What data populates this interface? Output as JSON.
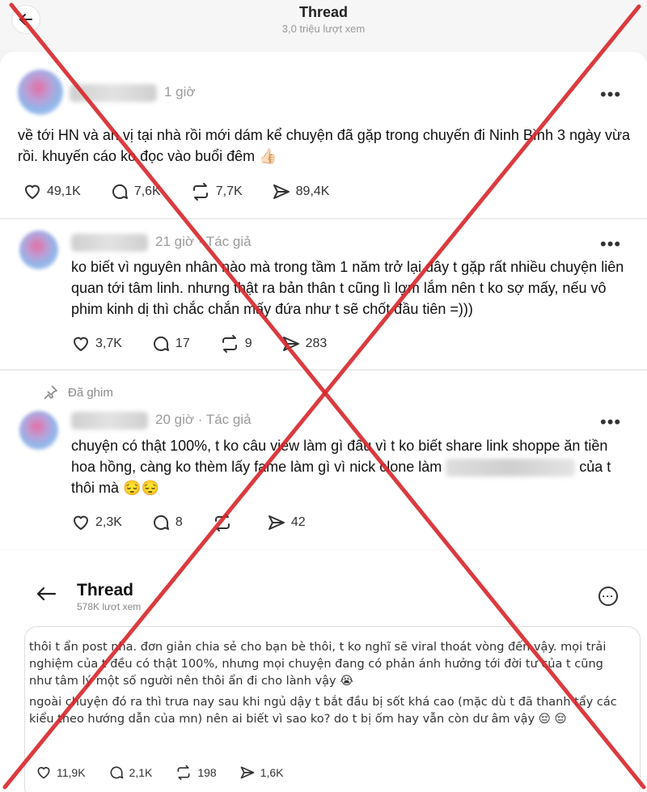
{
  "header": {
    "title": "Thread",
    "views": "3,0 triệu lượt xem"
  },
  "post1": {
    "time": "1 giờ",
    "text": "về tới HN và an vị tại nhà rồi mới dám kể chuyện đã gặp trong chuyến đi Ninh Bình 3 ngày vừa rồi. khuyến cáo ko đọc vào buổi đêm 👍🏻",
    "likes": "49,1K",
    "replies": "7,6K",
    "reposts": "7,7K",
    "shares": "89,4K"
  },
  "post2": {
    "time": "21 giờ · Tác giả",
    "text": "ko biết vì nguyên nhân nào mà trong tầm 1 năm trở lại đây t gặp rất nhiều chuyện liên quan tới tâm linh. nhưng thật ra bản thân t cũng lì lợm lắm nên t ko sợ mấy, nếu vô phim kinh dị thì chắc chắn mấy đứa như t sẽ chốt đầu tiên =)))",
    "likes": "3,7K",
    "replies": "17",
    "reposts": "9",
    "shares": "283"
  },
  "post3": {
    "pinned": "Đã ghim",
    "time": "20 giờ · Tác giả",
    "text_a": "chuyện có thật 100%, t ko câu view làm gì đâu vì t ko biết share link shoppe ăn tiền hoa hồng, càng ko thèm lấy fame làm gì vì nick clone làm",
    "text_b": "của t thôi mà 😔😔",
    "likes": "2,3K",
    "replies": "8",
    "shares": "42"
  },
  "inner": {
    "title": "Thread",
    "views": "578K lượt xem",
    "para1": "thôi t ẩn post nha. đơn giản chia sẻ cho bạn bè thôi, t ko nghĩ sẽ viral thoát vòng đến vậy. mọi trải nghiệm của t đều có thật 100%, nhưng mọi chuyện đang có phản ánh hưởng tới đời tư của t cũng như tâm lý một số người nên thôi ẩn đi cho lành vậy 😭",
    "para2": "ngoài chuyện đó ra thì trưa nay sau khi ngủ dậy t bắt đầu bị sốt khá cao (mặc dù t đã thanh tẩy các kiểu theo hướng dẫn của mn) nên ai biết vì sao ko? do t bị ốm hay vẫn còn dư âm vậy 😔 😔",
    "likes": "11,9K",
    "replies": "2,1K",
    "reposts": "198",
    "shares": "1,6K"
  },
  "colors": {
    "cross": "#d8262b",
    "muted": "#9b9b9b"
  }
}
